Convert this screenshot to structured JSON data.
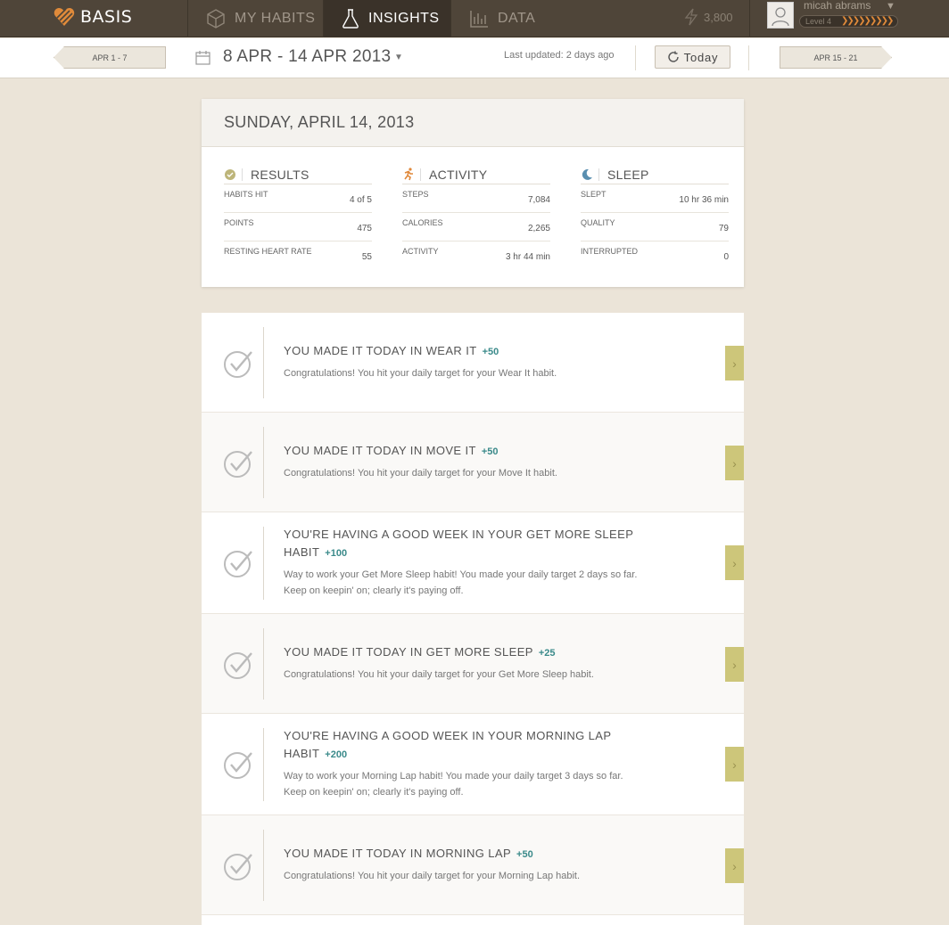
{
  "app": {
    "brand": "BASIS"
  },
  "nav": {
    "tabs": [
      {
        "label": "MY HABITS",
        "icon": "cube-icon"
      },
      {
        "label": "INSIGHTS",
        "icon": "flask-icon",
        "active": true
      },
      {
        "label": "DATA",
        "icon": "bar-chart-icon"
      }
    ],
    "points": "3,800",
    "user": {
      "name": "micah abrams",
      "level": "Level 4"
    }
  },
  "subbar": {
    "prev_week": "APR 1 - 7",
    "next_week": "APR 15 - 21",
    "date_range": "8 APR - 14 APR 2013",
    "last_updated": "Last updated: 2 days ago",
    "today_label": "Today"
  },
  "summary": {
    "date": "SUNDAY, APRIL 14, 2013",
    "columns": [
      {
        "title": "RESULTS",
        "icon": "checkmark-badge-icon",
        "stats": [
          {
            "label": "HABITS HIT",
            "value": "4 of 5"
          },
          {
            "label": "POINTS",
            "value": "475"
          },
          {
            "label": "RESTING HEART RATE",
            "value": "55"
          }
        ]
      },
      {
        "title": "ACTIVITY",
        "icon": "runner-icon",
        "stats": [
          {
            "label": "STEPS",
            "value": "7,084"
          },
          {
            "label": "CALORIES",
            "value": "2,265"
          },
          {
            "label": "ACTIVITY",
            "value": "3 hr 44 min"
          }
        ]
      },
      {
        "title": "SLEEP",
        "icon": "moon-icon",
        "stats": [
          {
            "label": "SLEPT",
            "value": "10 hr 36 min"
          },
          {
            "label": "QUALITY",
            "value": "79"
          },
          {
            "label": "INTERRUPTED",
            "value": "0"
          }
        ]
      }
    ]
  },
  "insights": [
    {
      "title": "YOU MADE IT TODAY IN WEAR IT",
      "points": "+50",
      "desc": "Congratulations! You hit your daily target for your Wear It habit."
    },
    {
      "title": "YOU MADE IT TODAY IN MOVE IT",
      "points": "+50",
      "desc": "Congratulations! You hit your daily target for your Move It habit."
    },
    {
      "title": "YOU'RE HAVING A GOOD WEEK IN YOUR GET MORE SLEEP HABIT",
      "points": "+100",
      "desc": "Way to work your Get More Sleep habit! You made your daily target 2 days so far. Keep on keepin' on; clearly it's paying off."
    },
    {
      "title": "YOU MADE IT TODAY IN GET MORE SLEEP",
      "points": "+25",
      "desc": "Congratulations! You hit your daily target for your Get More Sleep habit."
    },
    {
      "title": "YOU'RE HAVING A GOOD WEEK IN YOUR MORNING LAP HABIT",
      "points": "+200",
      "desc": "Way to work your Morning Lap habit! You made your daily target 3 days so far. Keep on keepin' on; clearly it's paying off."
    },
    {
      "title": "YOU MADE IT TODAY IN MORNING LAP",
      "points": "+50",
      "desc": "Congratulations! You hit your daily target for your Morning Lap habit."
    }
  ],
  "colors": {
    "nav_bg": "#4f4539",
    "nav_active": "#3a3229",
    "page_bg": "#ebe4d8",
    "accent_arrow": "#cdc67a",
    "points_text": "#3a8a8a"
  }
}
